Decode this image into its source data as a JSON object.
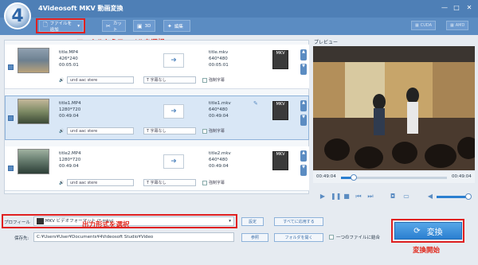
{
  "app": {
    "logo_number": "4",
    "title": "4Videosoft MKV 動画変換",
    "window_buttons": [
      "—",
      "□",
      "✕"
    ]
  },
  "toolbar": {
    "add_file": "ファイルを追加",
    "cut": "カット",
    "three_d": "3D",
    "edit": "編集",
    "cuda": "CUDA",
    "amd": "AMD"
  },
  "annotations": {
    "select_local_file": "ローカルからファイルを選択",
    "select_output_format": "出力形式を選択",
    "start_conversion": "変換開始"
  },
  "files": [
    {
      "src_name": "title.MP4",
      "src_res": "426*240",
      "src_dur": "00:05:01",
      "dst_name": "title.mkv",
      "dst_res": "640*480",
      "dst_dur": "00:05:01",
      "audio": "und aac stere",
      "subtitle": "字幕なし",
      "forced_sub": "強制字幕"
    },
    {
      "src_name": "title1.MP4",
      "src_res": "1280*720",
      "src_dur": "00:49:04",
      "dst_name": "title1.mkv",
      "dst_res": "640*480",
      "dst_dur": "00:49:04",
      "audio": "und aac stere",
      "subtitle": "字幕なし",
      "forced_sub": "強制字幕"
    },
    {
      "src_name": "title2.MP4",
      "src_res": "1280*720",
      "src_dur": "00:49:04",
      "dst_name": "title2.mkv",
      "dst_res": "640*480",
      "dst_dur": "00:49:04",
      "audio": "und aac stere",
      "subtitle": "字幕なし",
      "forced_sub": "強制字幕"
    }
  ],
  "format_badge": "MKV",
  "preview": {
    "label": "プレビュー",
    "time_start": "00:49:04",
    "time_end": "00:49:04",
    "progress": 0.12
  },
  "bottom": {
    "profile_label": "プロフィール",
    "profile_value": "MKV ビデオフォーマット (*.mkv)",
    "settings_button": "設定",
    "apply_all_button": "すべてに応用する",
    "save_label": "保存先:",
    "save_path": "C:¥Users¥User¥Documents¥4Videosoft Studio¥Video",
    "browse_button": "参照",
    "open_folder_button": "フォルダを開く",
    "merge_label": "一つのファイルに結合",
    "convert_button": "変換"
  },
  "colors": {
    "titlebar": "#4e7fb6",
    "toolbar": "#5b8cc2",
    "annotation_red": "#e02020",
    "convert_blue": "#2b7fd0"
  }
}
